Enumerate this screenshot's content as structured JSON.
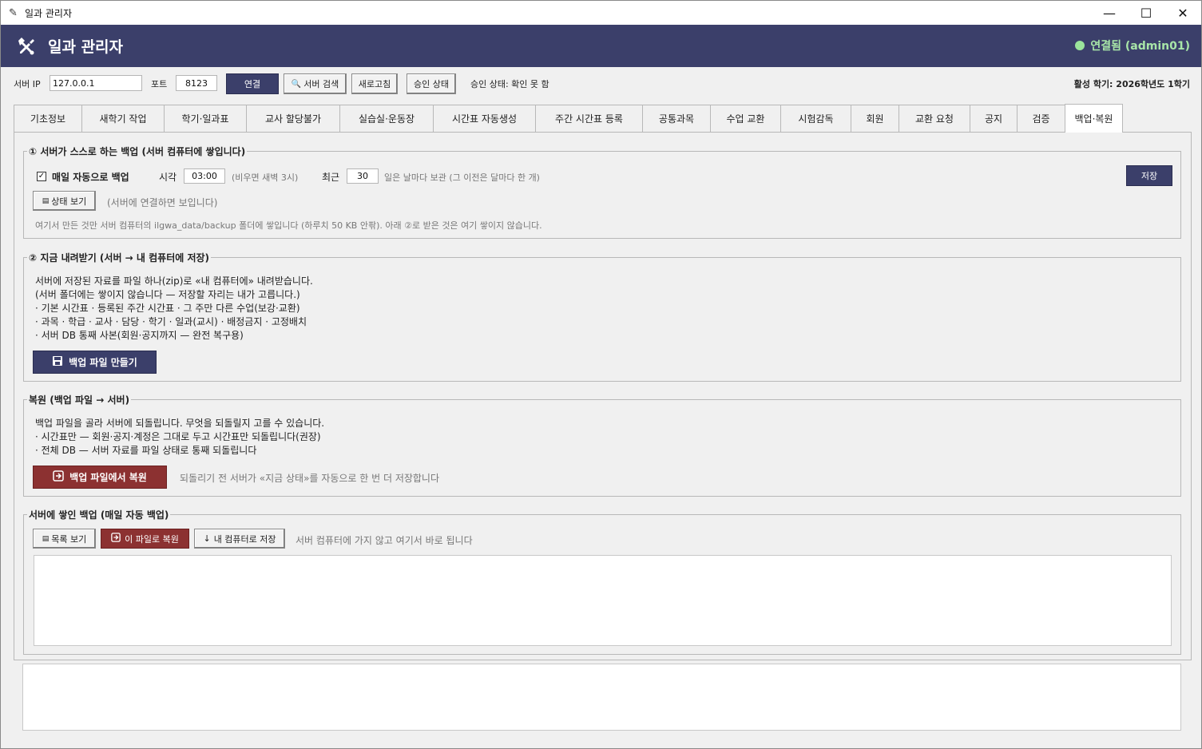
{
  "window": {
    "title": "일과 관리자",
    "controls": [
      "—",
      "☐",
      "✕"
    ]
  },
  "header": {
    "title": "일과 관리자",
    "status": "연결됨 (admin01)",
    "status_color": "#9be49b"
  },
  "connection": {
    "server_ip_label": "서버 IP",
    "server_ip_value": "127.0.0.1",
    "port_label": "포트",
    "port_value": "8123",
    "connect_label": "연결",
    "search_label": "서버 검색",
    "refresh_label": "새로고침",
    "approval_label": "승인 상태",
    "approval_status": "승인 상태: 확인 못 함",
    "active_term": "활성 학기: 2026학년도 1학기"
  },
  "tabs": [
    {
      "label": "기초정보"
    },
    {
      "label": "새학기 작업"
    },
    {
      "label": "학기·일과표"
    },
    {
      "label": "교사 할당불가"
    },
    {
      "label": "실습실·운동장"
    },
    {
      "label": "시간표 자동생성"
    },
    {
      "label": "주간 시간표 등록"
    },
    {
      "label": "공통과목"
    },
    {
      "label": "수업 교환"
    },
    {
      "label": "시험감독"
    },
    {
      "label": "회원"
    },
    {
      "label": "교환 요청"
    },
    {
      "label": "공지"
    },
    {
      "label": "검증"
    },
    {
      "label": "백업·복원"
    }
  ],
  "server_backup": {
    "title": "① 서버가 스스로 하는 백업 (서버 컴퓨터에 쌓입니다)",
    "auto_label": "매일 자동으로 백업",
    "time_label": "시각",
    "time_value": "03:00",
    "time_hint": "(비우면 새벽 3시)",
    "recent_label": "최근",
    "recent_value": "30",
    "recent_hint": "일은 날마다 보관 (그 이전은 달마다 한 개)",
    "save_label": "저장",
    "status_button": "상태 보기",
    "status_hint": "(서버에 연결하면 보입니다)",
    "note": "여기서 만든 것만 서버 컴퓨터의 ilgwa_data/backup 폴더에 쌓입니다 (하루치 50 KB 안팎). 아래 ②로 받은 것은 여기 쌓이지 않습니다."
  },
  "download": {
    "title": "② 지금 내려받기 (서버 → 내 컴퓨터에 저장)",
    "lines": [
      "서버에 저장된 자료를 파일 하나(zip)로 «내 컴퓨터에» 내려받습니다.",
      "(서버 폴더에는 쌓이지 않습니다 — 저장할 자리는 내가 고릅니다.)",
      "· 기본 시간표 · 등록된 주간 시간표 · 그 주만 다른 수업(보강·교환)",
      "· 과목 · 학급 · 교사 · 담당 · 학기 · 일과(교시) · 배정금지 · 고정배치",
      "· 서버 DB 통째 사본(회원·공지까지 — 완전 복구용)"
    ],
    "button": "백업 파일 만들기"
  },
  "restore": {
    "title": "복원 (백업 파일 → 서버)",
    "lines": [
      "백업 파일을 골라 서버에 되돌립니다. 무엇을 되돌릴지 고를 수 있습니다.",
      "· 시간표만 — 회원·공지·계정은 그대로 두고 시간표만 되돌립니다(권장)",
      "· 전체 DB — 서버 자료를 파일 상태로 통째 되돌립니다"
    ],
    "button": "백업 파일에서 복원",
    "hint": "되돌리기 전 서버가 «지금 상태»를 자동으로 한 번 더 저장합니다"
  },
  "stored": {
    "title": "서버에 쌓인 백업 (매일 자동 백업)",
    "list_button": "목록 보기",
    "restore_button": "이 파일로 복원",
    "save_button": "내 컴퓨터로 저장",
    "hint": "서버 컴퓨터에 가지 않고 여기서 바로 됩니다"
  }
}
